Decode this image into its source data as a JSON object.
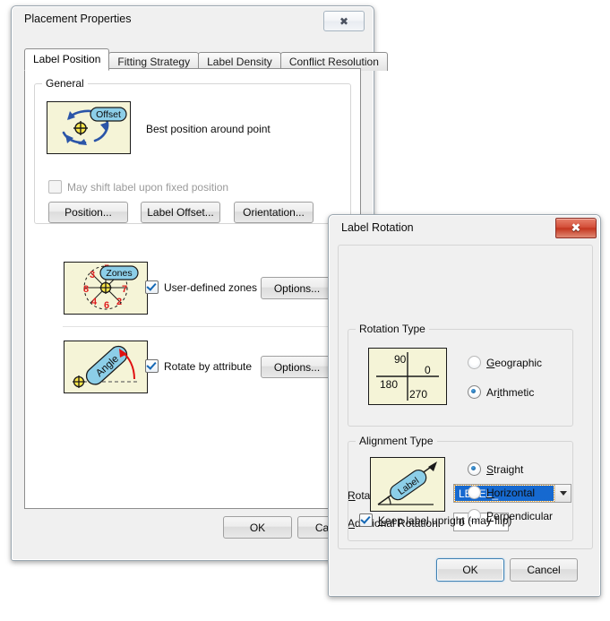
{
  "parent_dialog": {
    "title": "Placement Properties",
    "close_icon": "close-icon",
    "tabs": [
      {
        "label": "Label Position",
        "active": true
      },
      {
        "label": "Fitting Strategy",
        "active": false
      },
      {
        "label": "Label Density",
        "active": false
      },
      {
        "label": "Conflict Resolution",
        "active": false
      }
    ],
    "general_group": {
      "legend": "General",
      "preview_label": "Offset",
      "description": "Best position around point",
      "shift_checkbox": {
        "label": "May shift label upon fixed position",
        "checked": false,
        "disabled": true
      },
      "buttons": [
        {
          "label": "Position..."
        },
        {
          "label": "Label Offset..."
        },
        {
          "label": "Orientation..."
        }
      ]
    },
    "zones_row": {
      "preview_label": "Zones",
      "preview_numbers": [
        "3",
        "5",
        "8",
        "7",
        "4",
        "6",
        "2"
      ],
      "checkbox": {
        "label": "User-defined zones",
        "checked": true
      },
      "options_button": "Options..."
    },
    "rotate_row": {
      "preview_label": "Angle",
      "checkbox": {
        "label": "Rotate by attribute",
        "checked": true
      },
      "options_button": "Options..."
    },
    "footer": {
      "ok": "OK",
      "cancel": "Cancel"
    }
  },
  "child_dialog": {
    "title": "Label Rotation",
    "close_icon": "close-icon",
    "rotation_field": {
      "label": "Rotation Field:",
      "label_accesskey": "R",
      "value": "LEVEL_",
      "options": [
        "LEVEL_"
      ]
    },
    "additional_rotation": {
      "label": "Additional Rotation:",
      "label_accesskey": "A",
      "value": "0"
    },
    "rotation_type": {
      "legend": "Rotation Type",
      "preview_ticks": [
        "90",
        "0",
        "180",
        "270"
      ],
      "options": [
        {
          "label": "Geographic",
          "accesskey": "G",
          "selected": false
        },
        {
          "label": "Arithmetic",
          "accesskey": "i",
          "selected": true
        }
      ]
    },
    "alignment_type": {
      "legend": "Alignment Type",
      "preview_label": "Label",
      "options": [
        {
          "label": "Straight",
          "accesskey": "S",
          "selected": true
        },
        {
          "label": "Horizontal",
          "accesskey": "H",
          "selected": false
        },
        {
          "label": "Perpendicular",
          "accesskey": "P",
          "selected": false
        }
      ],
      "upright_checkbox": {
        "label": "Keep label upright (may flip)",
        "checked": true
      }
    },
    "footer": {
      "ok": "OK",
      "cancel": "Cancel"
    }
  },
  "colors": {
    "preview_bg": "#f5f4d7",
    "accent_blue": "#1669d0",
    "label_pill": "#8ccee8",
    "zone_number_red": "#e01f1f",
    "arrow_blue": "#2b55a8",
    "angle_arrow_red": "#e01010",
    "close_red": "#c4361f"
  }
}
